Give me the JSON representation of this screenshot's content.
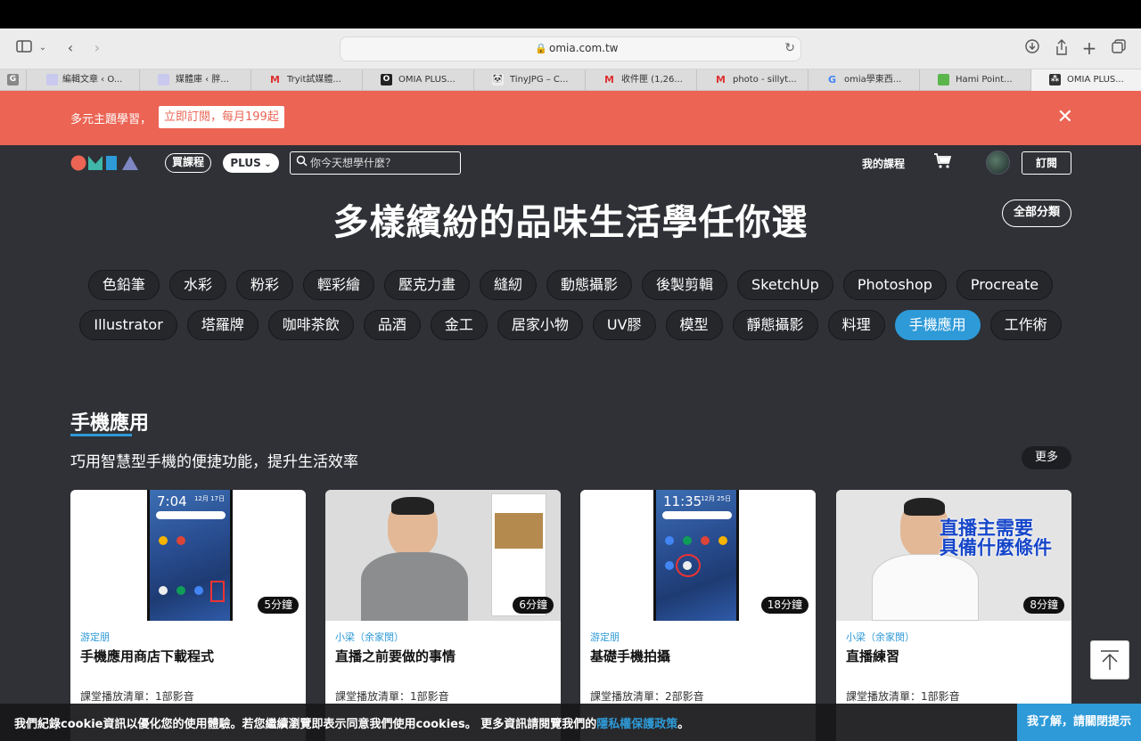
{
  "browser": {
    "url": "omia.com.tw",
    "tabs": [
      {
        "label": "編輯文章 ‹ O...",
        "icon": "wordpress-icon"
      },
      {
        "label": "媒體庫 ‹ 胖...",
        "icon": "wordpress-icon"
      },
      {
        "label": "Tryit試媒體...",
        "icon": "gmail-icon"
      },
      {
        "label": "OMIA PLUS...",
        "icon": "omia-icon"
      },
      {
        "label": "TinyJPG – C...",
        "icon": "panda-icon"
      },
      {
        "label": "收件匣 (1,26...",
        "icon": "gmail-icon"
      },
      {
        "label": "photo - sillyt...",
        "icon": "gmail-icon"
      },
      {
        "label": "omia學東西...",
        "icon": "google-icon"
      },
      {
        "label": "Hami Point...",
        "icon": "hami-icon"
      },
      {
        "label": "OMIA PLUS...",
        "icon": "omia-plus-icon"
      }
    ]
  },
  "promo": {
    "text": "多元主題學習，",
    "cta": "立即訂閱，每月199起"
  },
  "nav": {
    "buy_courses": "買課程",
    "plus": "PLUS",
    "search_placeholder": "你今天想學什麼？",
    "my_courses": "我的課程",
    "subscribe": "訂閱"
  },
  "hero": {
    "title": "多樣繽紛的品味生活學任你選",
    "all_categories": "全部分類"
  },
  "categories": {
    "row1": [
      "色鉛筆",
      "水彩",
      "粉彩",
      "輕彩繪",
      "壓克力畫",
      "縫紉",
      "動態攝影",
      "後製剪輯",
      "SketchUp",
      "Photoshop",
      "Procreate"
    ],
    "row2": [
      "Illustrator",
      "塔羅牌",
      "咖啡茶飲",
      "品酒",
      "金工",
      "居家小物",
      "UV膠",
      "模型",
      "靜態攝影",
      "料理",
      "手機應用",
      "工作術"
    ],
    "active": "手機應用"
  },
  "section": {
    "title": "手機應用",
    "subtitle": "巧用智慧型手機的便捷功能，提升生活效率",
    "more": "更多"
  },
  "cards": [
    {
      "author": "游定朋",
      "title": "手機應用商店下載程式",
      "duration": "5分鐘",
      "playlist": "課堂播放清單：1部影音",
      "thumb_time": "7:04",
      "thumb_date": "12月 17日"
    },
    {
      "author": "小梁（余家閔）",
      "title": "直播之前要做的事情",
      "duration": "6分鐘",
      "playlist": "課堂播放清單：1部影音"
    },
    {
      "author": "游定朋",
      "title": "基礎手機拍攝",
      "duration": "18分鐘",
      "playlist": "課堂播放清單：2部影音",
      "thumb_time": "11:35",
      "thumb_date": "12月 25日"
    },
    {
      "author": "小梁（余家閔）",
      "title": "直播練習",
      "duration": "8分鐘",
      "playlist": "課堂播放清單：1部影音",
      "thumb_caption_line1": "直播主需要",
      "thumb_caption_line2": "具備什麼條件"
    }
  ],
  "cookie": {
    "message": "我們紀錄cookie資訊以優化您的使用體驗。若您繼續瀏覽即表示同意我們使用cookies。 更多資訊請閱覽我們的",
    "policy_link": "隱私權保護政策",
    "period": "。",
    "button": "我了解，請關閉提示"
  },
  "colors": {
    "page_bg": "#2f3136",
    "promo_bg": "#eb6454",
    "accent": "#2e9ad8"
  }
}
